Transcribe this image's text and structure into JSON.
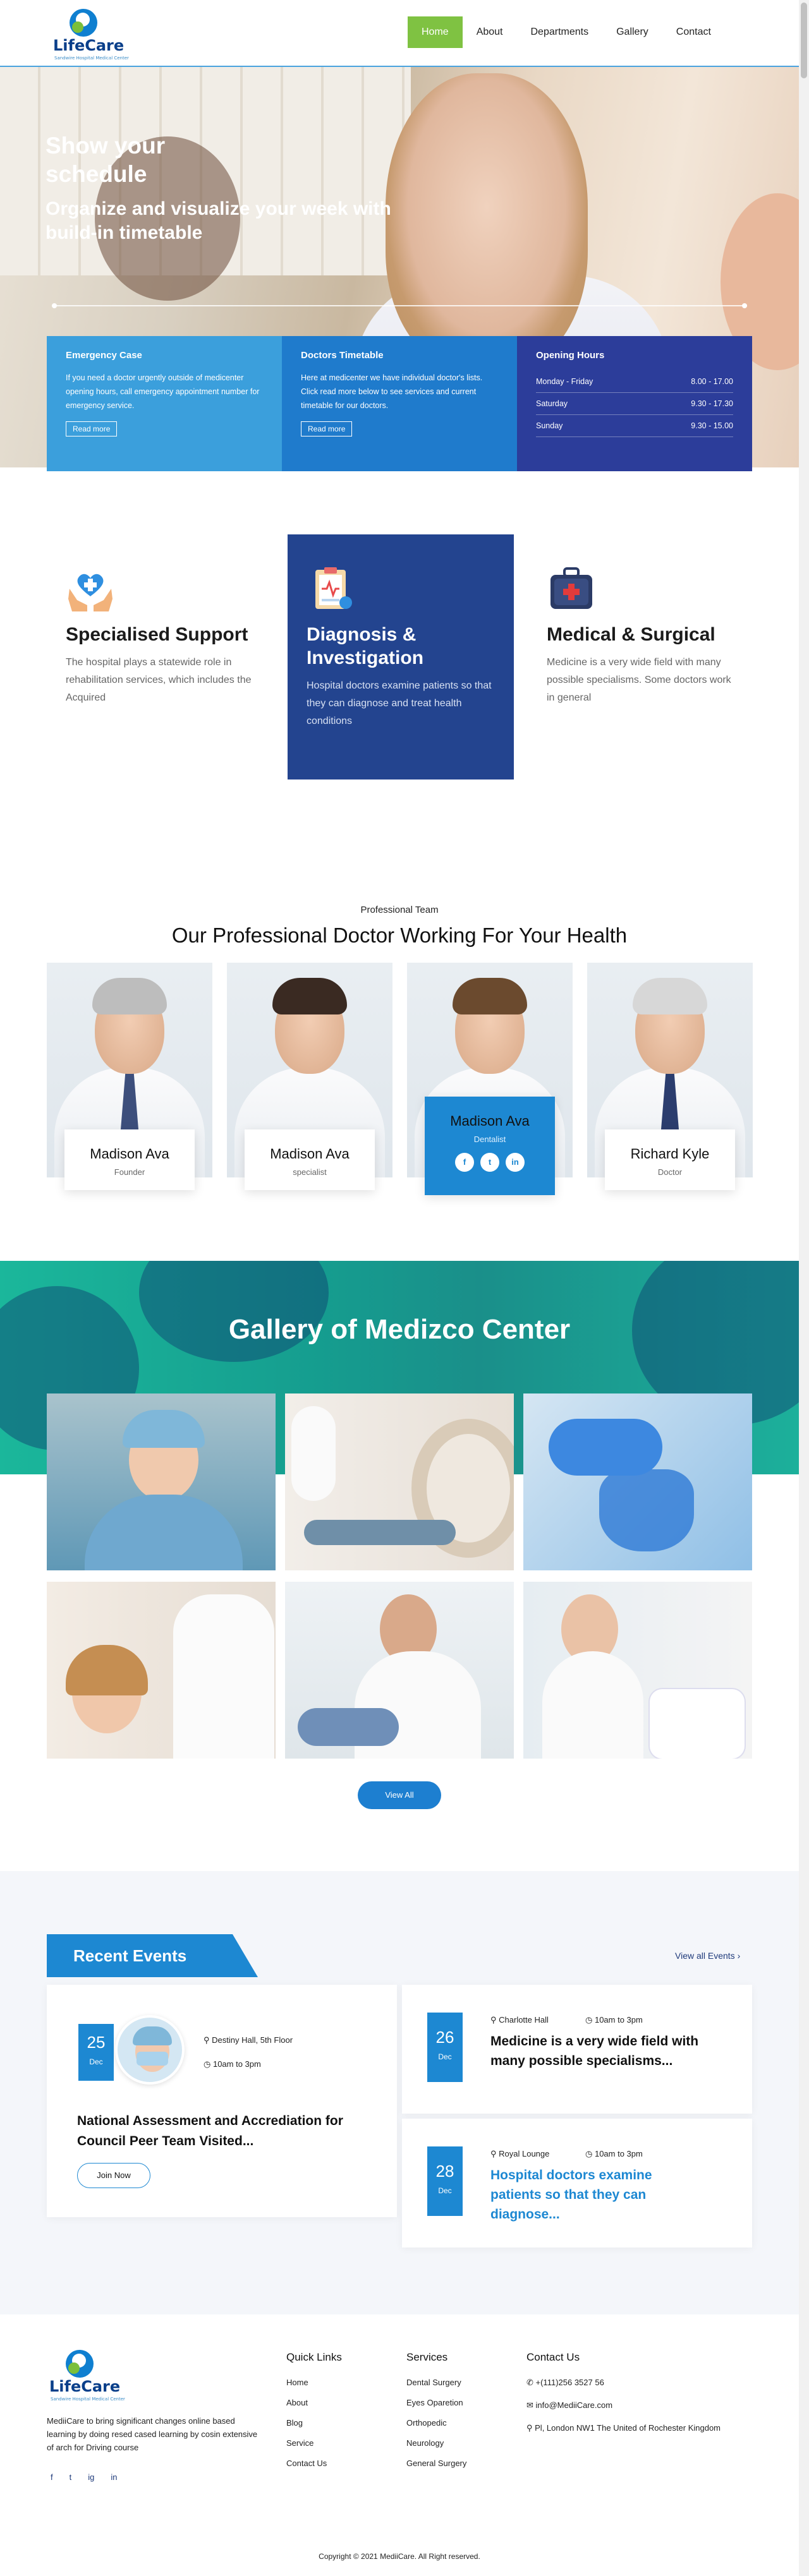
{
  "brand": {
    "name": "LifeCare",
    "tagline": "Sandwire Hospital Medical Center"
  },
  "nav": [
    "Home",
    "About",
    "Departments",
    "Gallery",
    "Contact"
  ],
  "hero": {
    "title": "Show your schedule",
    "subtitle": "Organize and visualize your week with build-in timetable"
  },
  "info": {
    "emergency": {
      "title": "Emergency Case",
      "text": "If you need a doctor urgently outside of medicenter opening hours, call emergency appointment number for emergency service.",
      "btn": "Read more"
    },
    "timetable": {
      "title": "Doctors Timetable",
      "text": "Here at medicenter we have individual doctor's lists. Click read more below to see services and current timetable for our doctors.",
      "btn": "Read more"
    },
    "hours": {
      "title": "Opening Hours",
      "rows": [
        {
          "day": "Monday - Friday",
          "time": "8.00 - 17.00"
        },
        {
          "day": "Saturday",
          "time": "9.30 - 17.30"
        },
        {
          "day": "Sunday",
          "time": "9.30 - 15.00"
        }
      ]
    }
  },
  "features": [
    {
      "title": "Specialised Support",
      "text": "The hospital plays a statewide role in rehabilitation services, which includes the Acquired"
    },
    {
      "title": "Diagnosis & Investigation",
      "text": "Hospital doctors examine patients so that they can diagnose and treat health conditions"
    },
    {
      "title": "Medical & Surgical",
      "text": "Medicine is a very wide field with many possible specialisms. Some doctors work in general"
    }
  ],
  "team": {
    "kicker": "Professional Team",
    "title": "Our Professional Doctor Working For Your Health",
    "doctors": [
      {
        "name": "Madison Ava",
        "role": "Founder"
      },
      {
        "name": "Madison Ava",
        "role": "specialist"
      },
      {
        "name": "Madison Ava",
        "role": "Dentalist"
      },
      {
        "name": "Richard Kyle",
        "role": "Doctor"
      }
    ],
    "socials": [
      "f",
      "t",
      "in"
    ]
  },
  "gallery": {
    "title": "Gallery of Medizco Center",
    "button": "View All"
  },
  "events": {
    "tag": "Recent Events",
    "view_all": "View all Events ›",
    "big": {
      "day": "25",
      "month": "Dec",
      "place": "Destiny Hall, 5th Floor",
      "time": "10am to 3pm",
      "title": "National Assessment and Accrediation for Council Peer Team Visited...",
      "btn": "Join Now"
    },
    "small": [
      {
        "day": "26",
        "month": "Dec",
        "place": "Charlotte Hall",
        "time": "10am to 3pm",
        "title": "Medicine is a very wide field with many possible specialisms..."
      },
      {
        "day": "28",
        "month": "Dec",
        "place": "Royal Lounge",
        "time": "10am to 3pm",
        "title": "Hospital doctors examine patients so that they can diagnose..."
      }
    ]
  },
  "footer": {
    "desc": "MediiCare to bring significant changes online based learning by doing resed cased learning by cosin extensive of arch for Driving course",
    "social": [
      "f",
      "t",
      "ig",
      "in"
    ],
    "quick": {
      "title": "Quick Links",
      "links": [
        "Home",
        "About",
        "Blog",
        "Service",
        "Contact Us"
      ]
    },
    "services": {
      "title": "Services",
      "links": [
        "Dental Surgery",
        "Eyes Oparetion",
        "Orthopedic",
        "Neurology",
        "General Surgery"
      ]
    },
    "contact": {
      "title": "Contact Us",
      "phone": "+(111)256 3527 56",
      "email": "info@MediiCare.com",
      "address": "Pl, London NW1 The United of Rochester Kingdom"
    },
    "copyright": "Copyright © 2021 MediiCare. All Right reserved."
  },
  "colors": {
    "green": "#7fc242",
    "blue": "#1d88d2",
    "navy": "#23448f",
    "teal": "#1bb79b"
  }
}
